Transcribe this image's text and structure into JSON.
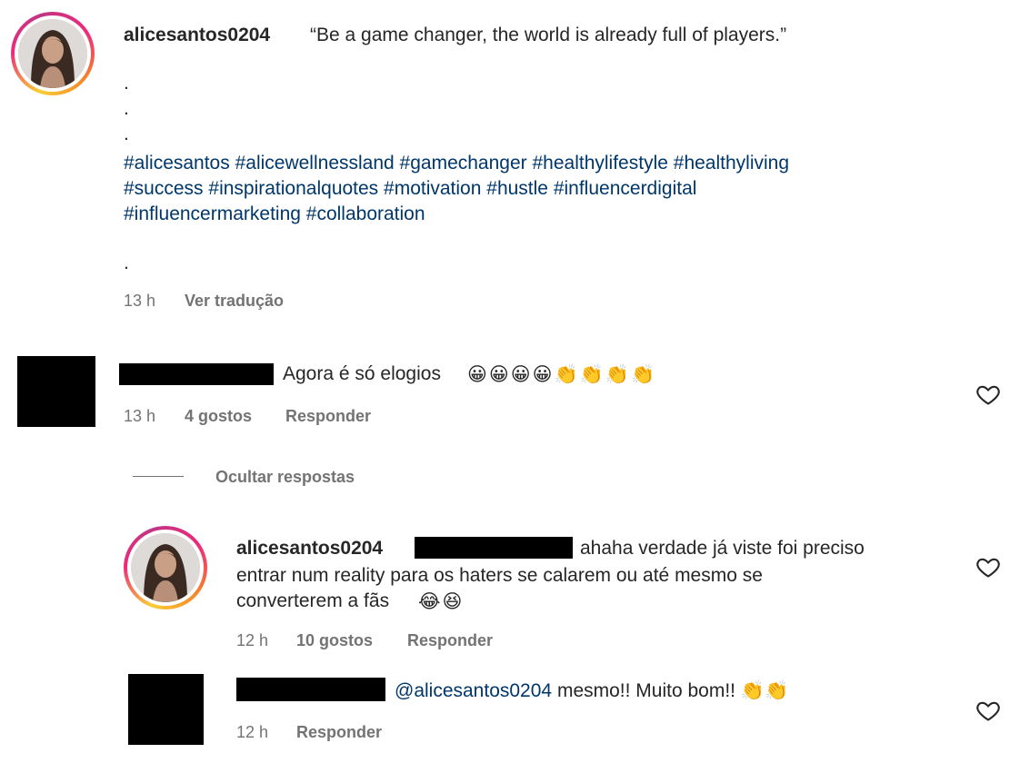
{
  "post": {
    "username": "alicesantos0204",
    "caption": "“Be a game changer, the world is already full of players.”",
    "dots": [
      ".",
      ".",
      ".",
      "."
    ],
    "hashtags_line1": [
      "#alicesantos",
      "#alicewellnessland",
      "#gamechanger",
      "#healthylifestyle",
      "#healthyliving"
    ],
    "hashtags_line2": [
      "#success",
      "#inspirationalquotes",
      "#motivation",
      "#hustle",
      "#influencerdigital"
    ],
    "hashtags_line3": [
      "#influencermarketing",
      "#collaboration"
    ],
    "time": "13 h",
    "translate": "Ver tradução"
  },
  "comment1": {
    "text": "Agora é só elogios",
    "emojis": "😀😀😀😀👏👏👏👏",
    "time": "13 h",
    "likes": "4 gostos",
    "reply": "Responder"
  },
  "hide_replies": "Ocultar respostas",
  "reply1": {
    "username": "alicesantos0204",
    "text_line1": "ahaha verdade já viste foi preciso",
    "text_line2": "entrar num reality para os haters se calarem ou até mesmo se",
    "text_line3": "converterem a fãs",
    "emojis": "😂😆",
    "time": "12 h",
    "likes": "10 gostos",
    "reply": "Responder"
  },
  "reply2": {
    "mention": "@alicesantos0204",
    "text": "mesmo!! Muito bom!!",
    "emojis": "👏👏",
    "time": "12 h",
    "reply": "Responder"
  },
  "icons": {
    "heart": "heart-outline-icon"
  }
}
